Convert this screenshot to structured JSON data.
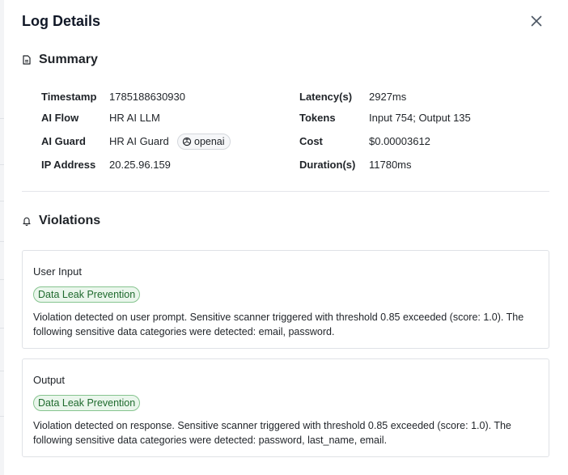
{
  "dialog": {
    "title": "Log Details"
  },
  "summary": {
    "heading": "Summary",
    "timestamp_label": "Timestamp",
    "timestamp_value": "1785188630930",
    "ai_flow_label": "AI Flow",
    "ai_flow_value": "HR AI LLM",
    "ai_guard_label": "AI Guard",
    "ai_guard_value": "HR AI Guard",
    "provider_badge": "openai",
    "ip_label": "IP Address",
    "ip_value": "20.25.96.159",
    "latency_label": "Latency(s)",
    "latency_value": "2927ms",
    "tokens_label": "Tokens",
    "tokens_value": "Input 754; Output 135",
    "cost_label": "Cost",
    "cost_value": "$0.00003612",
    "duration_label": "Duration(s)",
    "duration_value": "11780ms"
  },
  "violations": {
    "heading": "Violations",
    "items": [
      {
        "title": "User Input",
        "tag": "Data Leak Prevention",
        "text": "Violation detected on user prompt. Sensitive scanner triggered with threshold 0.85 exceeded (score: 1.0). The following sensitive data categories were detected: email, password."
      },
      {
        "title": "Output",
        "tag": "Data Leak Prevention",
        "text": "Violation detected on response. Sensitive scanner triggered with threshold 0.85 exceeded (score: 1.0). The following sensitive data categories were detected: password, last_name, email."
      }
    ]
  },
  "colors": {
    "tag_border": "#86c48f",
    "tag_background": "#eaf6ec",
    "tag_text": "#1e6a2d"
  },
  "icons": {
    "close": "close-icon",
    "summary": "document-icon",
    "violations": "bell-icon",
    "provider": "openai-logo-icon"
  }
}
